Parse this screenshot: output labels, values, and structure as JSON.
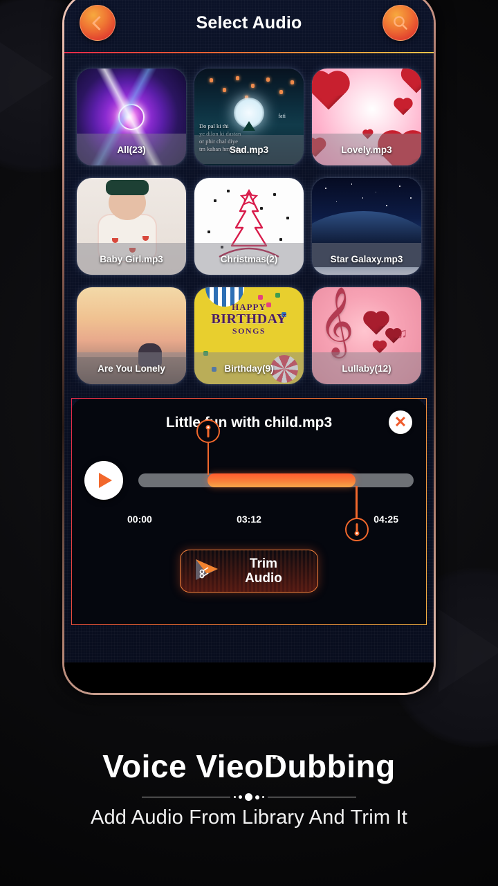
{
  "header": {
    "title": "Select Audio",
    "back_icon": "chevron-left-icon",
    "search_icon": "search-icon"
  },
  "grid": {
    "tiles": [
      {
        "label": "All(23)",
        "art": "purple-spiral"
      },
      {
        "label": "Sad.mp3",
        "art": "night-lanterns"
      },
      {
        "label": "Lovely.mp3",
        "art": "pink-hearts"
      },
      {
        "label": "Baby Girl.mp3",
        "art": "baby-photo"
      },
      {
        "label": "Christmas(2)",
        "art": "christmas-tree"
      },
      {
        "label": "Star Galaxy.mp3",
        "art": "starry-planet"
      },
      {
        "label": "Are You Lonely",
        "art": "sunset-person"
      },
      {
        "label": "Birthday(9)",
        "art": "happy-birthday-songs"
      },
      {
        "label": "Lullaby(12)",
        "art": "treble-clef-hearts"
      }
    ],
    "sad_tile": {
      "verse_line1": "Do pal ki thi",
      "verse_line2": "ye dilon ki dastan",
      "verse_line3": "or phir chal diye",
      "verse_line4": "tm kahan hm kahan",
      "signature": "fati"
    },
    "birthday_tile": {
      "line1": "HAPPY",
      "line2": "BIRTHDAY",
      "line3": "SONGS"
    }
  },
  "player": {
    "track_title": "Little fun with child.mp3",
    "close_icon": "close-icon",
    "play_icon": "play-icon",
    "start_time": "00:00",
    "current_time": "03:12",
    "end_time": "04:25",
    "trim_start_percent": 25,
    "trim_end_percent": 79,
    "trim_button_line1": "Trim",
    "trim_button_line2": "Audio",
    "trim_icon": "play-scissors-icon"
  },
  "banner": {
    "title_part1": "Voice Vi",
    "title_part2": "eo ",
    "title_d": "D",
    "title_rest": "ubbing",
    "subtitle": "Add Audio From Library And Trim It"
  },
  "colors": {
    "accent_orange": "#f2682c",
    "accent_red": "#e8294a",
    "accent_yellow": "#f3b143",
    "screen_bg": "#0a1024",
    "panel_bg": "#05070e"
  }
}
